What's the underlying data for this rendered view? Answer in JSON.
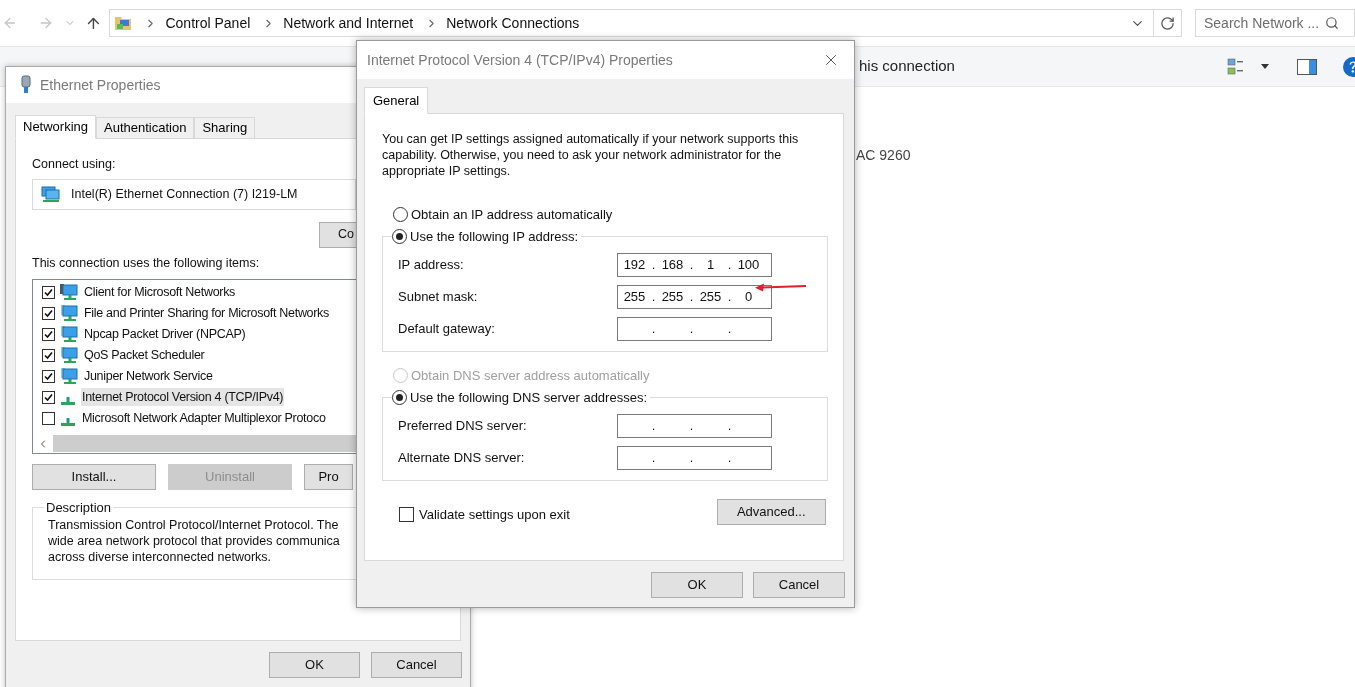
{
  "explorer": {
    "breadcrumb": [
      "Control Panel",
      "Network and Internet",
      "Network Connections"
    ],
    "search": {
      "placeholder": "Search Network ..."
    },
    "toolbar_text": "his connection",
    "content_text": "AC 9260"
  },
  "ethernet_window": {
    "title": "Ethernet Properties",
    "tabs": [
      {
        "label": "Networking",
        "selected": true
      },
      {
        "label": "Authentication",
        "selected": false
      },
      {
        "label": "Sharing",
        "selected": false
      }
    ],
    "connect_label": "Connect using:",
    "adapter": "Intel(R) Ethernet Connection (7) I219-LM",
    "configure_button": "Co",
    "items_label": "This connection uses the following items:",
    "items": [
      {
        "label": "Client for Microsoft Networks",
        "checked": true,
        "selected": false,
        "kind": "client"
      },
      {
        "label": "File and Printer Sharing for Microsoft Networks",
        "checked": true,
        "selected": false,
        "kind": "service"
      },
      {
        "label": "Npcap Packet Driver (NPCAP)",
        "checked": true,
        "selected": false,
        "kind": "service"
      },
      {
        "label": "QoS Packet Scheduler",
        "checked": true,
        "selected": false,
        "kind": "service"
      },
      {
        "label": "Juniper Network Service",
        "checked": true,
        "selected": false,
        "kind": "service"
      },
      {
        "label": "Internet Protocol Version 4 (TCP/IPv4)",
        "checked": true,
        "selected": true,
        "kind": "protocol"
      },
      {
        "label": "Microsoft Network Adapter Multiplexor Protoco",
        "checked": false,
        "selected": false,
        "kind": "protocol"
      }
    ],
    "buttons": [
      {
        "label": "Install...",
        "disabled": false
      },
      {
        "label": "Uninstall",
        "disabled": true
      },
      {
        "label": "Pro",
        "disabled": false
      }
    ],
    "description": {
      "legend": "Description",
      "lines": [
        "Transmission Control Protocol/Internet Protocol. The",
        "wide area network protocol that provides communica",
        "across diverse interconnected networks."
      ]
    },
    "footer_buttons": [
      "OK",
      "Cancel"
    ]
  },
  "ipv4_dialog": {
    "title": "Internet Protocol Version 4 (TCP/IPv4) Properties",
    "tabs": [
      {
        "label": "General",
        "selected": true
      }
    ],
    "intro": "You can get IP settings assigned automatically if your network supports this capability. Otherwise, you need to ask your network administrator for the appropriate IP settings.",
    "octet_separator": ".",
    "ip_mode": [
      {
        "label": "Obtain an IP address automatically",
        "selected": false,
        "disabled": false
      },
      {
        "label": "Use the following IP address:",
        "selected": true,
        "disabled": false
      }
    ],
    "ip_fields": [
      {
        "label": "IP address:",
        "octets": [
          "192",
          "168",
          "1",
          "100"
        ]
      },
      {
        "label": "Subnet mask:",
        "octets": [
          "255",
          "255",
          "255",
          "0"
        ]
      },
      {
        "label": "Default gateway:"
      }
    ],
    "dns_mode": [
      {
        "label": "Obtain DNS server address automatically",
        "selected": false,
        "disabled": true
      },
      {
        "label": "Use the following DNS server addresses:",
        "selected": true,
        "disabled": false
      }
    ],
    "dns_fields": [
      {
        "label": "Preferred DNS server:"
      },
      {
        "label": "Alternate DNS server:"
      }
    ],
    "validate": {
      "label": "Validate settings upon exit",
      "checked": false
    },
    "advanced_button": "Advanced...",
    "footer_buttons": [
      "OK",
      "Cancel"
    ]
  }
}
